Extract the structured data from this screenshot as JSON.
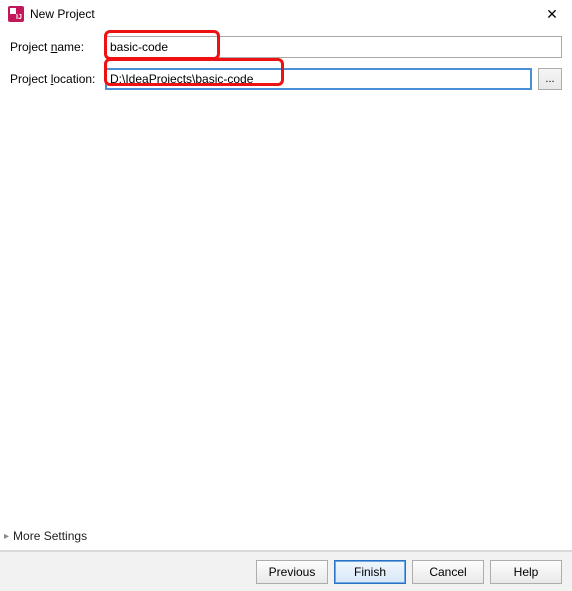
{
  "titlebar": {
    "title": "New Project",
    "close_glyph": "✕"
  },
  "form": {
    "name_label_pre": "Project ",
    "name_label_mn": "n",
    "name_label_post": "ame:",
    "name_value": "basic-code",
    "location_label_pre": "Project ",
    "location_label_mn": "l",
    "location_label_post": "ocation:",
    "location_value": "D:\\IdeaProjects\\basic-code",
    "browse_label": "..."
  },
  "more_settings": {
    "label": "More Settings",
    "triangle": "▸"
  },
  "buttons": {
    "previous": "Previous",
    "finish": "Finish",
    "cancel": "Cancel",
    "help": "Help"
  }
}
